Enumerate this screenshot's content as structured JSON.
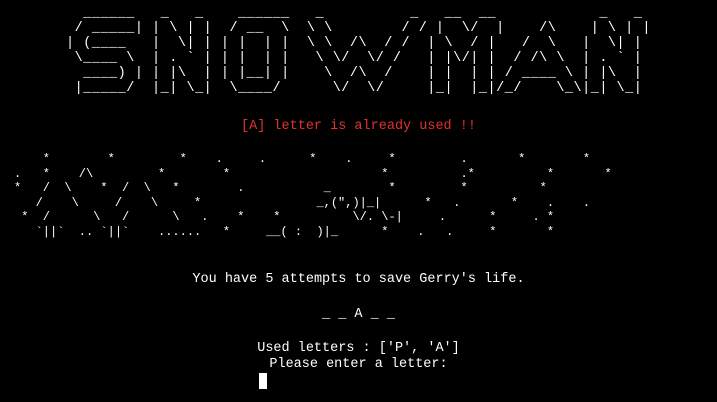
{
  "title_art": [
    "  ______   _   _    ______   _          _   __  __            _   _ ",
    " / _____| | \\ | |  / __  \\  \\ \\        / / |  \\/  |    /\\    | \\ | |",
    "| (____   |  \\| | | |  | |  \\ \\  /\\  / /  | \\  / |   /  \\   |  \\| |",
    " \\____ \\  | . ` | | |  | |   \\ \\/  \\/ /   | |\\/| |  / /\\ \\  | . ` |",
    "  ____) | | |\\  | | |__| |    \\  /\\  /    | |  | | / ____ \\ | |\\  |",
    " |_____/  |_| \\_|  \\____/      \\/  \\/     |_|  |_|/_/    \\_\\|_| \\_|"
  ],
  "message_used": "[A] letter is already used !!",
  "scene": [
    "    *        *         *    .     .      *    .     *         .       *        *",
    ".   *    /\\         *        *                     *          .*          *       *",
    "*   /  \\    *  /  \\   *        .           _        *         *          *",
    "   /    \\     /    \\     *                _,(\",)|_|      *   .       *    .    .",
    " *  /      \\   /      \\   .    *    *          \\/. \\-|     .      *     . *",
    "   `||`  .. `||`    ......   *     __( :  )|_      *    .   .     *       *"
  ],
  "attempts_text": "You have 5 attempts to save Gerry's life.",
  "word_display": "_ _ A _ _",
  "used_letters_text": "Used letters : ['P', 'A']",
  "prompt_text": "Please enter a letter:",
  "colors": {
    "background": "#000000",
    "text": "#ffffff",
    "error": "#e0332c"
  }
}
